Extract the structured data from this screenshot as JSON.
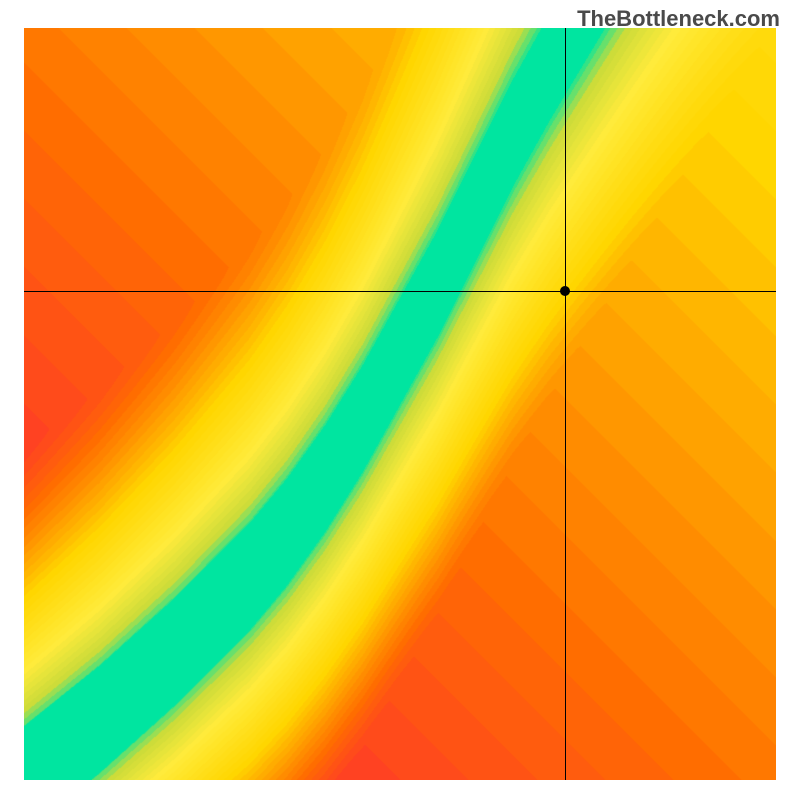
{
  "watermark": "TheBottleneck.com",
  "chart_data": {
    "type": "heatmap",
    "title": "",
    "xlabel": "",
    "ylabel": "",
    "xlim": [
      0,
      100
    ],
    "ylim": [
      0,
      100
    ],
    "crosshair": {
      "x": 72,
      "y": 65
    },
    "point": {
      "x": 72,
      "y": 65
    },
    "ridge": [
      {
        "x": 0,
        "y": 0
      },
      {
        "x": 10,
        "y": 8
      },
      {
        "x": 20,
        "y": 17
      },
      {
        "x": 30,
        "y": 27
      },
      {
        "x": 35,
        "y": 33
      },
      {
        "x": 40,
        "y": 40
      },
      {
        "x": 45,
        "y": 48
      },
      {
        "x": 50,
        "y": 57
      },
      {
        "x": 55,
        "y": 66
      },
      {
        "x": 60,
        "y": 76
      },
      {
        "x": 65,
        "y": 86
      },
      {
        "x": 70,
        "y": 95
      },
      {
        "x": 73,
        "y": 100
      }
    ],
    "colorStops": [
      {
        "t": 0.0,
        "color": "#ff1744"
      },
      {
        "t": 0.25,
        "color": "#ff6d00"
      },
      {
        "t": 0.5,
        "color": "#ffd600"
      },
      {
        "t": 0.75,
        "color": "#ffeb3b"
      },
      {
        "t": 0.9,
        "color": "#cddc39"
      },
      {
        "t": 1.0,
        "color": "#00e5a0"
      }
    ],
    "ridgeWidth": 6,
    "falloff": 38,
    "upperRightBias": true
  }
}
